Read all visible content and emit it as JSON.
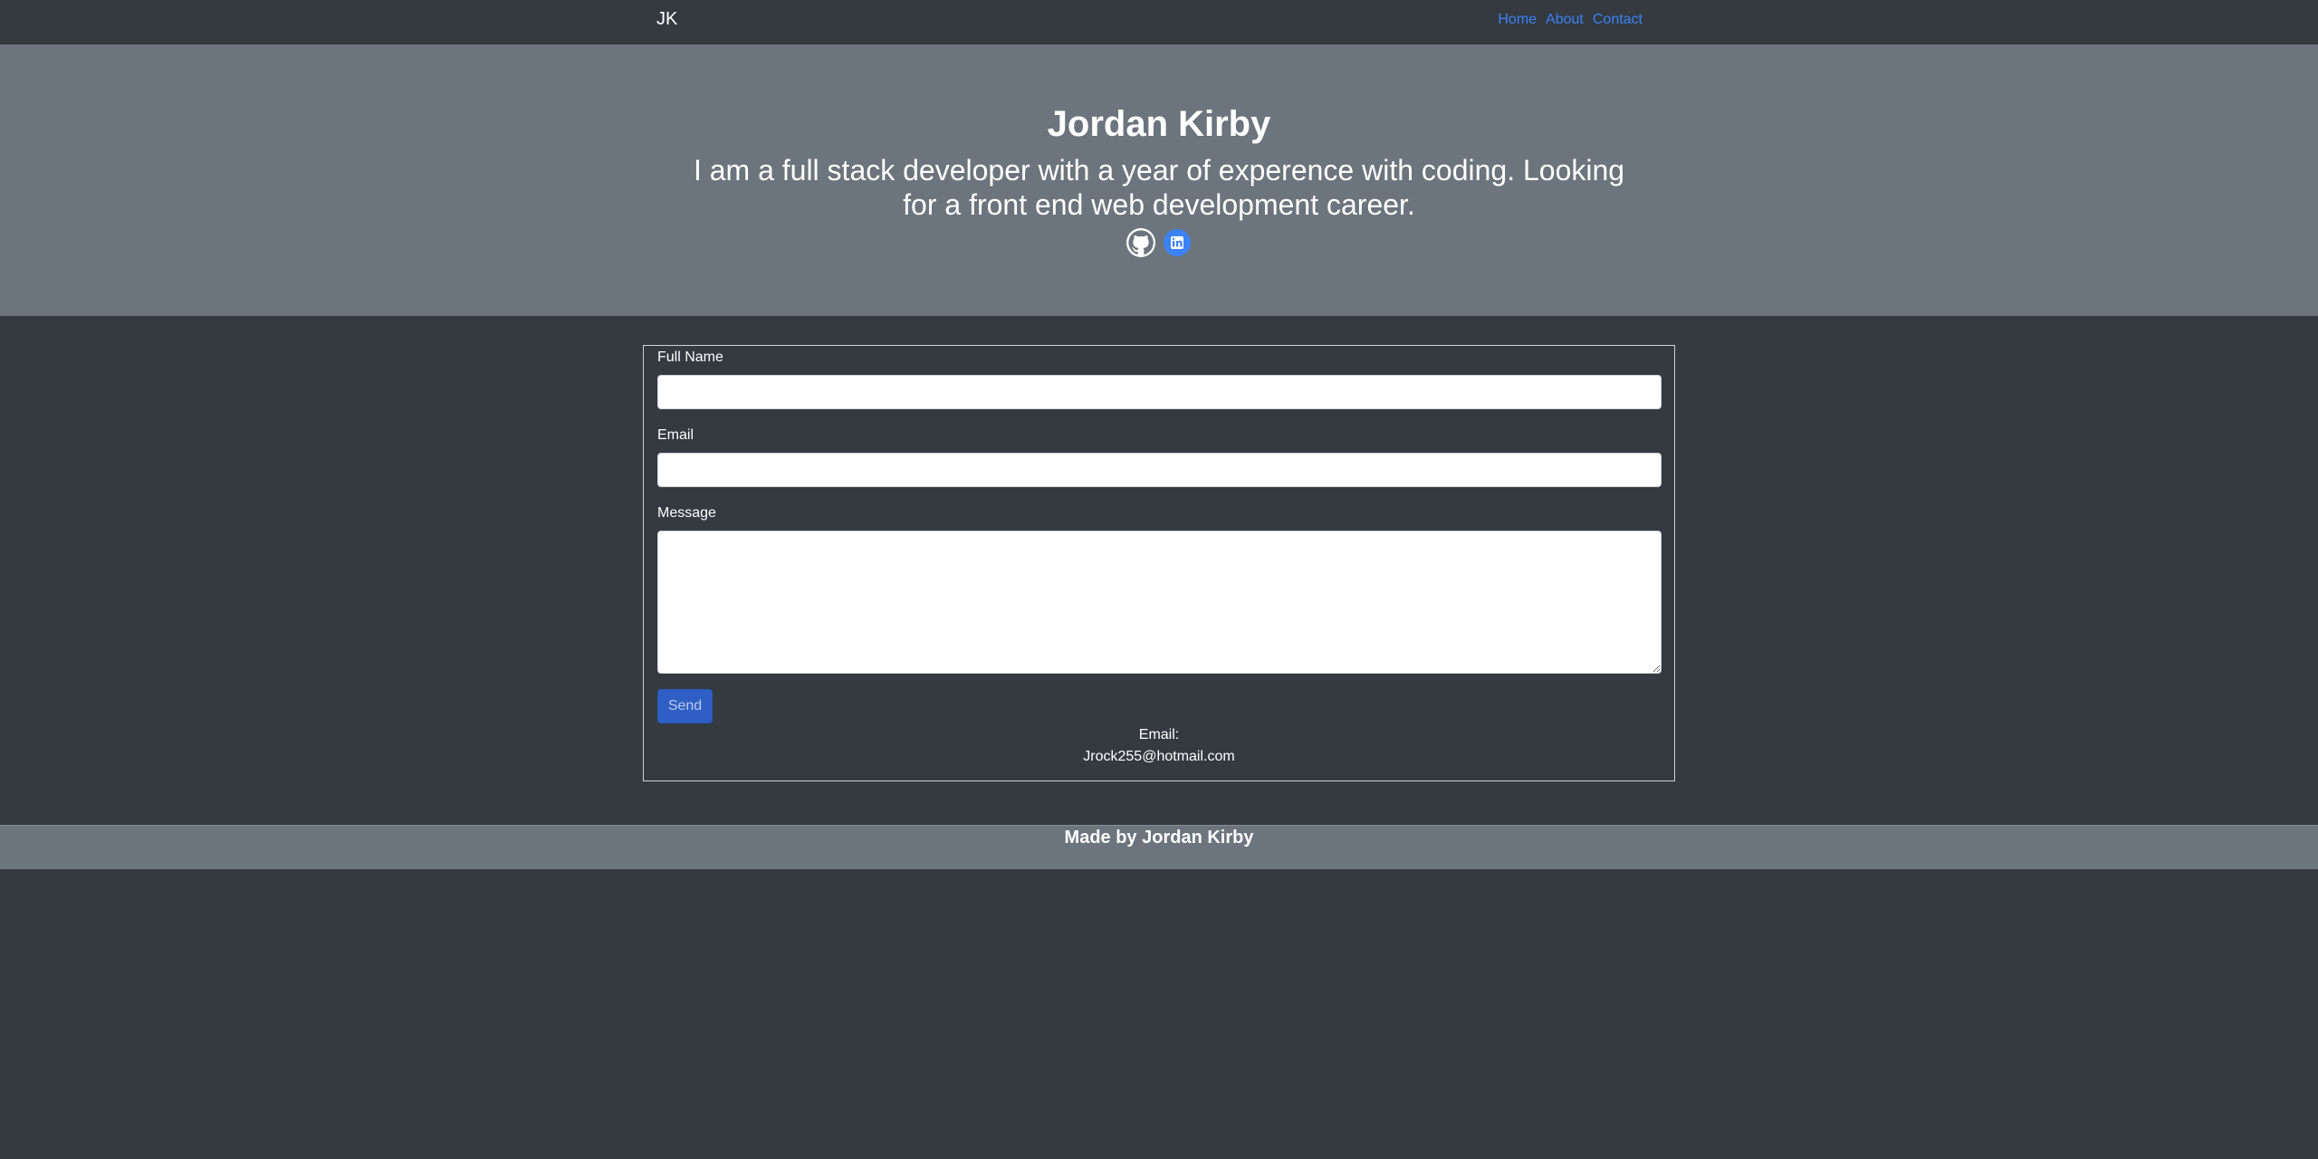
{
  "navbar": {
    "brand": "JK",
    "links": [
      "Home",
      "About",
      "Contact"
    ]
  },
  "hero": {
    "name": "Jordan Kirby",
    "lead": "I am a full stack developer with a year of experence with coding. Looking for a front end web development career.",
    "icons": [
      "github-icon",
      "linkedin-icon"
    ]
  },
  "form": {
    "full_name_label": "Full Name",
    "full_name_value": "",
    "email_label": "Email",
    "email_value": "",
    "message_label": "Message",
    "message_value": "",
    "send_label": "Send"
  },
  "contact": {
    "email_label": "Email:",
    "email_address": "Jrock255@hotmail.com"
  },
  "footer": {
    "text": "Made by Jordan Kirby"
  },
  "colors": {
    "page_bg": "#343a40",
    "hero_bg": "#6c757d",
    "link": "#3b82f6",
    "button": "#2f5fc4",
    "linkedin": "#3b82f6"
  }
}
